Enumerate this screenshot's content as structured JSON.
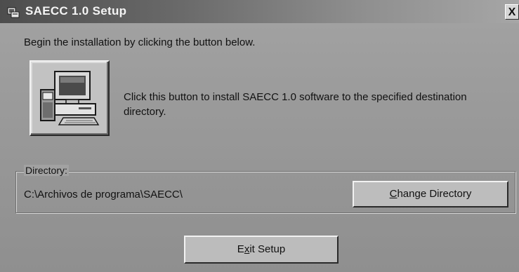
{
  "window": {
    "title": "SAECC 1.0 Setup",
    "close_label": "X"
  },
  "intro_text": "Begin the installation by clicking the button below.",
  "install": {
    "description": "Click this button to install SAECC 1.0 software to the specified destination directory.",
    "icon": "computer-install-icon"
  },
  "directory": {
    "group_label": "Directory:",
    "path": "C:\\Archivos de programa\\SAECC\\",
    "change_button": {
      "mnemonic": "C",
      "rest": "hange Directory"
    }
  },
  "exit_button": {
    "pre": "E",
    "mnemonic": "x",
    "post": "it Setup"
  }
}
